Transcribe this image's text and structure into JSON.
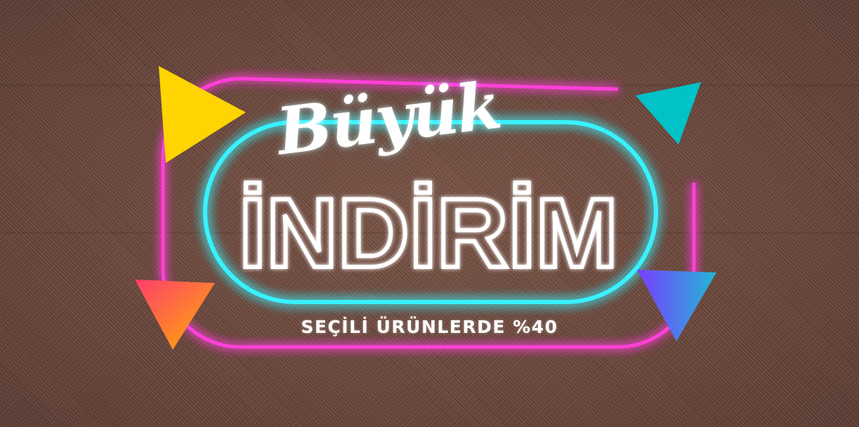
{
  "banner": {
    "script_title": "Büyük",
    "main_title": "İNDİRİM",
    "subtitle": "SEÇİLİ ÜRÜNLERDE %40"
  },
  "colors": {
    "background_fabric": "#6e4a3f",
    "neon_pink": "#ff3fd8",
    "neon_cyan": "#38f2ff",
    "triangle_yellow": "#ffd400",
    "triangle_teal": "#00c2c7",
    "triangle_orange_start": "#ff3d6e",
    "triangle_orange_end": "#ffb000",
    "triangle_purple_start": "#7a3cff",
    "triangle_purple_end": "#22b8d6",
    "text": "#ffffff"
  },
  "icons": [
    "triangle-yellow-icon",
    "triangle-teal-icon",
    "triangle-orange-icon",
    "triangle-purple-icon"
  ]
}
